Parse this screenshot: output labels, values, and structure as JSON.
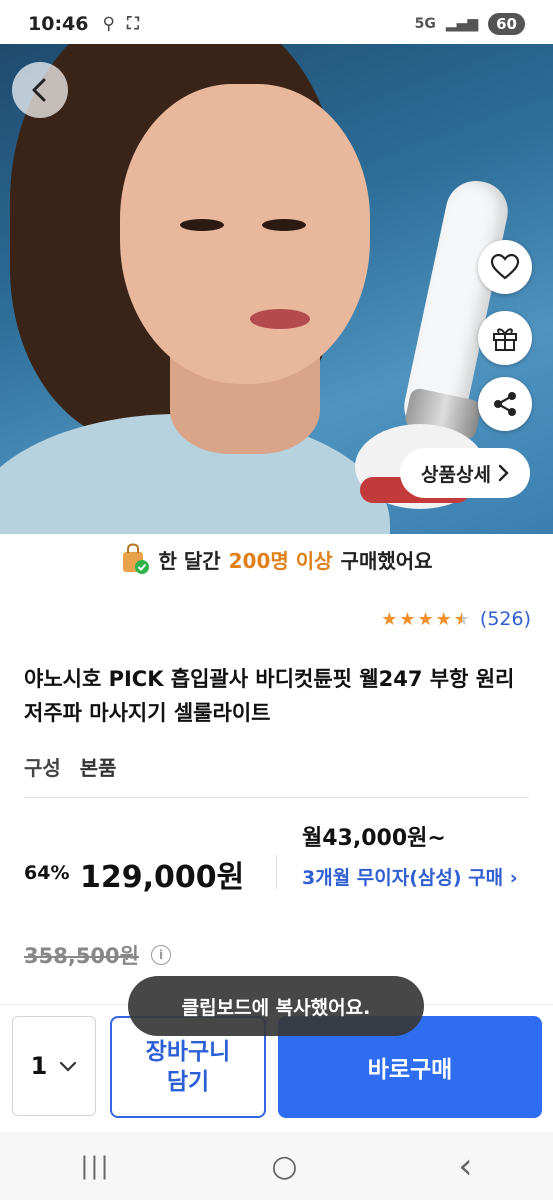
{
  "status_bar": {
    "time": "10:46",
    "network": "5G",
    "battery": "60",
    "icons": [
      "location-icon",
      "screenshot-icon",
      "wifi-icon",
      "signal-icon",
      "battery-icon"
    ]
  },
  "product_hero": {
    "detail_label": "상품상세",
    "icons": [
      "back-icon",
      "heart-icon",
      "gift-icon",
      "share-icon",
      "chevron-right-icon"
    ]
  },
  "purchase_banner": {
    "prefix": "한 달간",
    "highlight": "200명 이상",
    "suffix": "구매했어요"
  },
  "rating": {
    "stars": 4.5,
    "review_count": "(526)"
  },
  "product": {
    "title": "야노시호 PICK 흡입괄사 바디컷튠핏 웰247 부항 원리 저주파 마사지기 셀룰라이트",
    "option_label": "구성",
    "option_value": "본품"
  },
  "pricing": {
    "discount": "64%",
    "price": "129,000원",
    "monthly": "월43,000원~",
    "installment": "3개월 무이자(삼성) 구매 ›",
    "original_price": "358,500원",
    "info_symbol": "i"
  },
  "bottom_bar": {
    "quantity": "1",
    "cart_label": "장바구니\n담기",
    "buy_label": "바로구매"
  },
  "toast": {
    "message": "클립보드에 복사했어요."
  },
  "nav": {
    "recents": "|||",
    "home": "○",
    "back": "‹"
  },
  "colors": {
    "accent_blue": "#2e6cf0",
    "highlight_orange": "#e0801a",
    "star_orange": "#f2902a",
    "link_blue": "#2f5fd1"
  }
}
